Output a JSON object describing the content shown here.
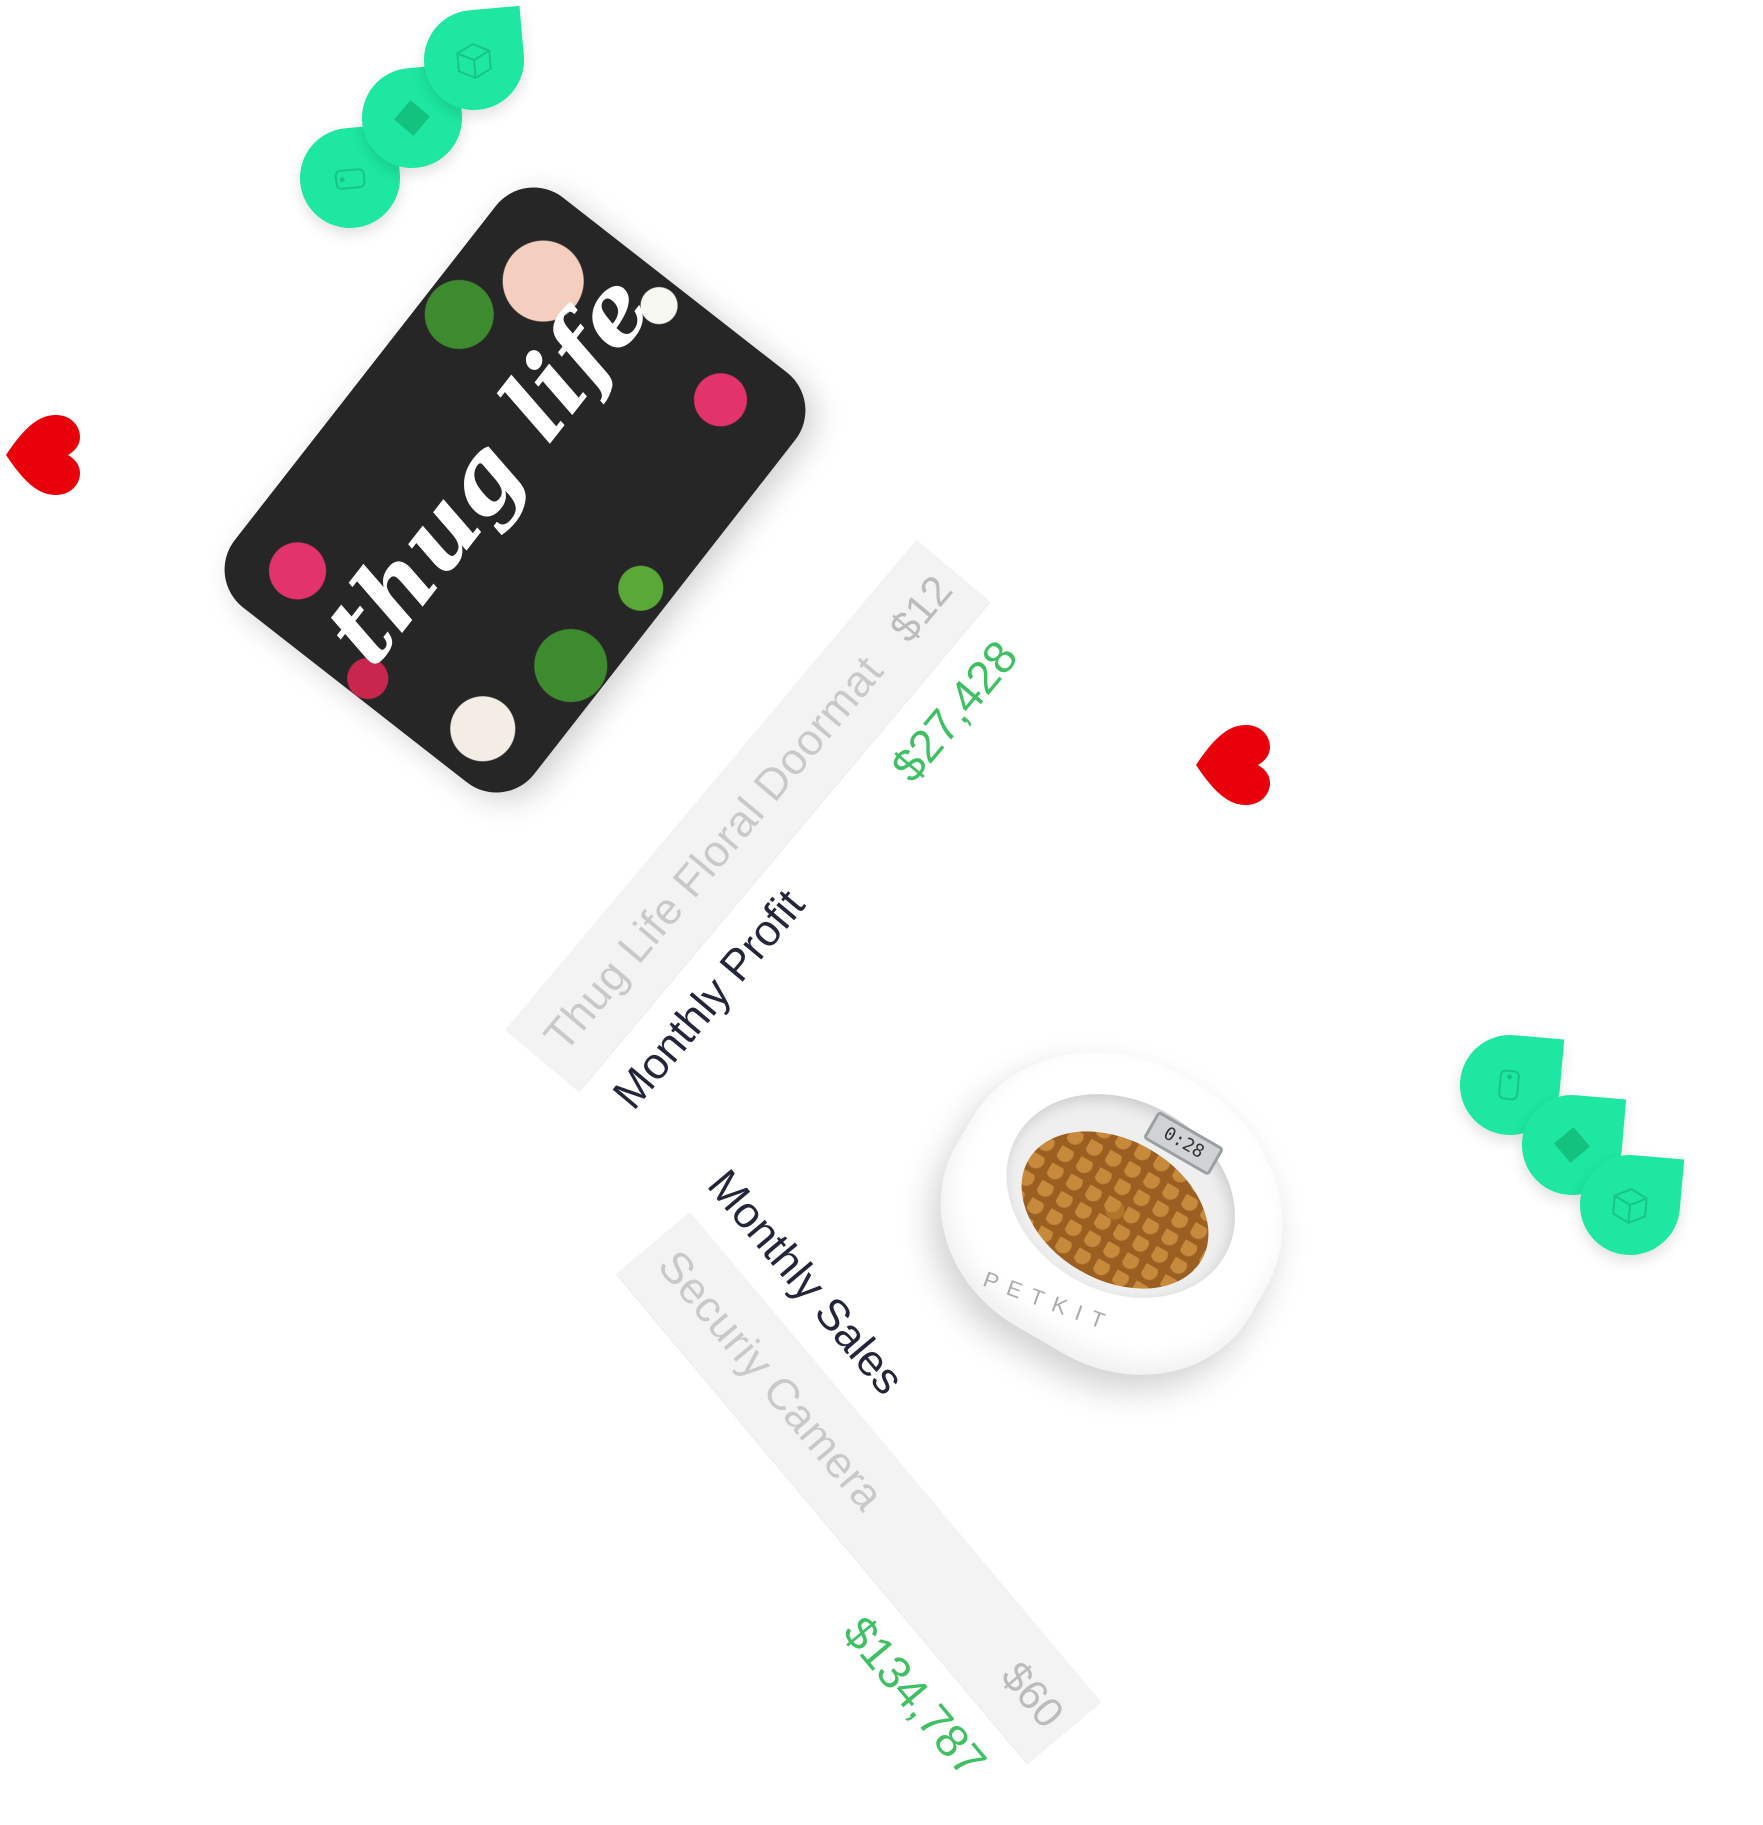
{
  "doormat": {
    "logo_text": "thug life"
  },
  "pet_bowl": {
    "display": "0:28",
    "brand": "PETKIT"
  },
  "card_profit": {
    "item_name": "Thug Life Floral Doormat",
    "item_price": "$12",
    "metric_label": "Monthly Profit",
    "metric_value": "$27,428"
  },
  "card_sales": {
    "item_name": "Securiy Camera",
    "item_price": "$60",
    "metric_label": "Monthly Sales",
    "metric_value": "$134,787"
  },
  "colors": {
    "accent_green": "#3fc163",
    "drop_green": "#1de7a0",
    "heart_red": "#e8000a",
    "text_dark": "#23263a"
  },
  "icons": [
    "tag-icon",
    "diamond-icon",
    "box-icon",
    "heart-icon"
  ]
}
